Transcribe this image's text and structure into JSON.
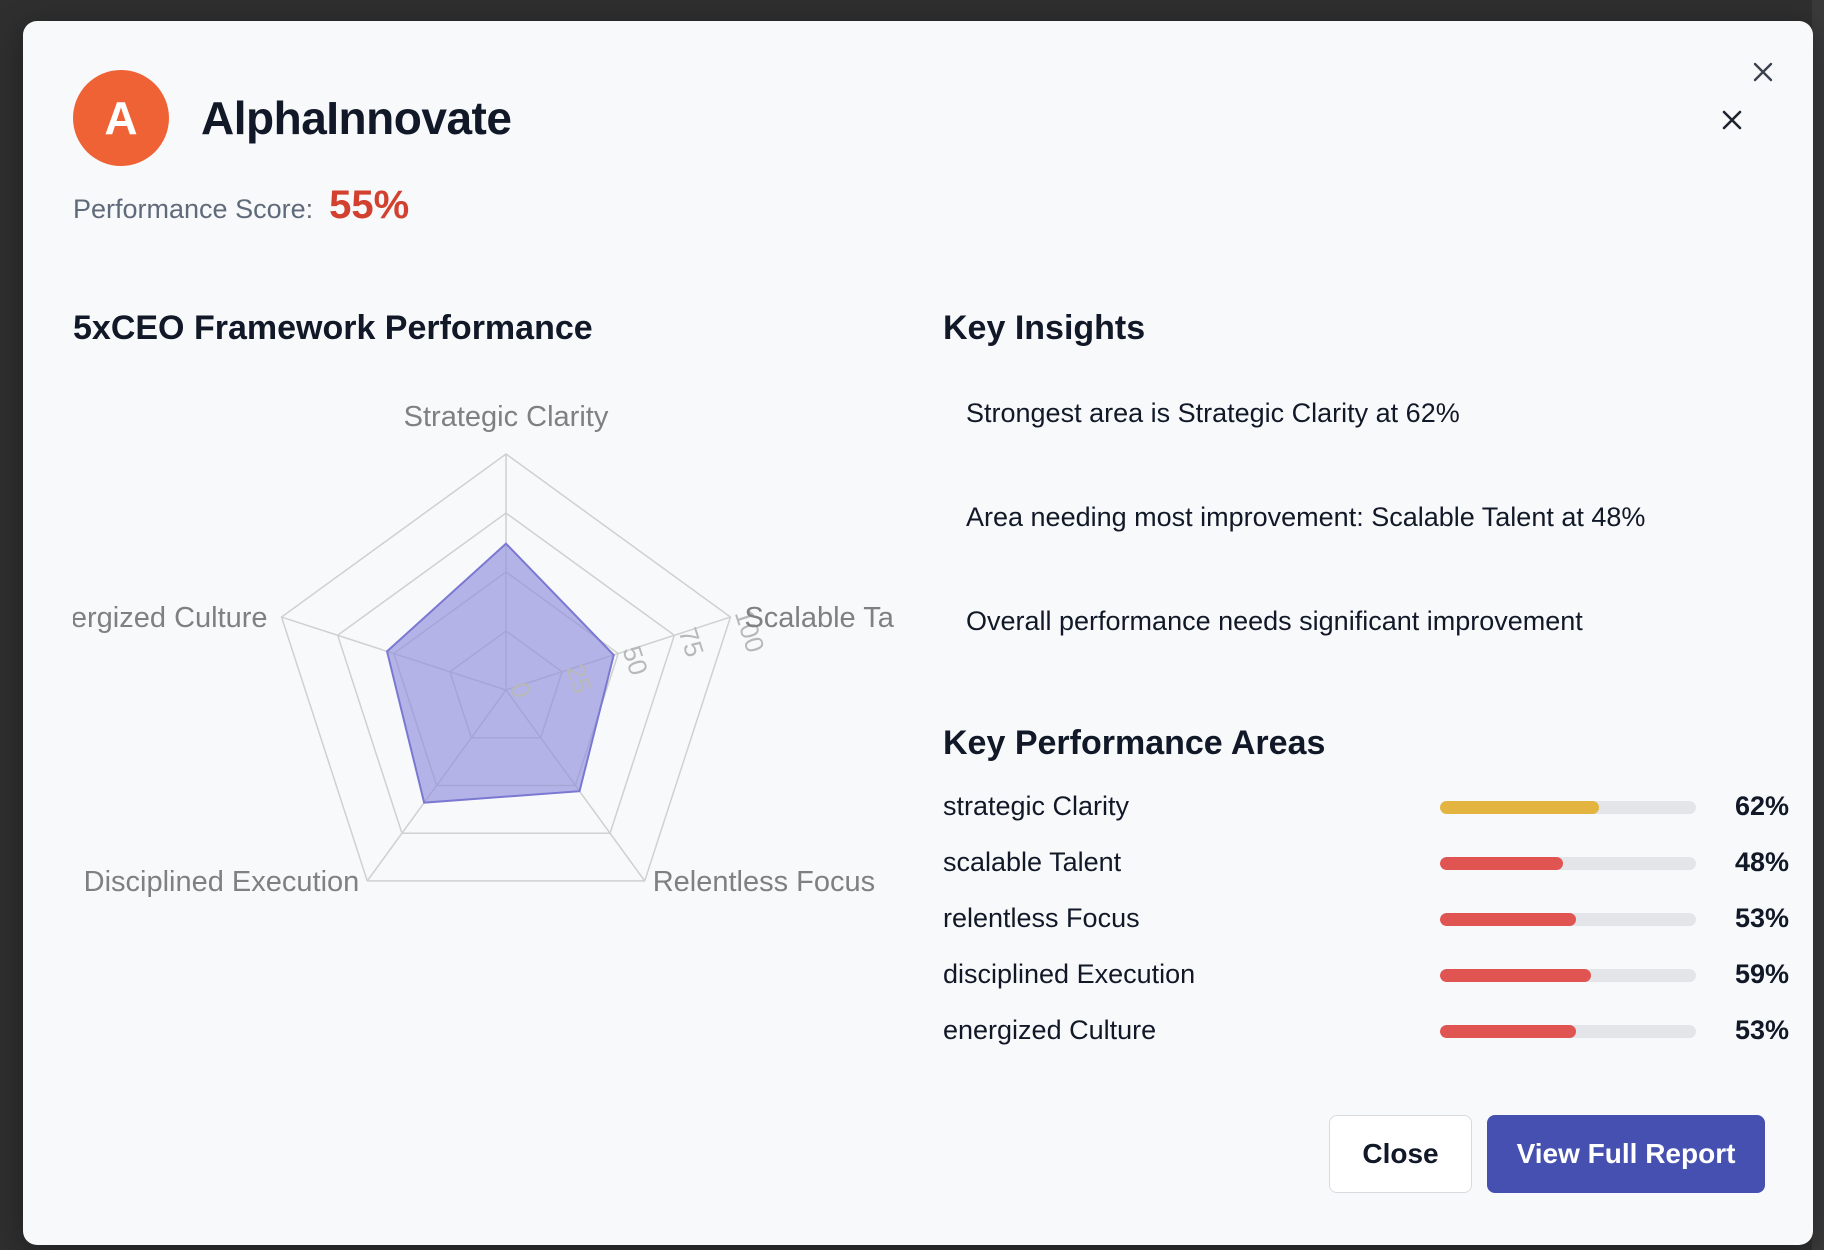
{
  "company": {
    "initial": "A",
    "name": "AlphaInnovate"
  },
  "score": {
    "label": "Performance Score:",
    "value": "55%"
  },
  "framework": {
    "title": "5xCEO Framework Performance"
  },
  "chart_data": {
    "type": "radar",
    "axes": [
      "Strategic Clarity",
      "Scalable Talent",
      "Relentless Focus",
      "Disciplined Execution",
      "Energized Culture"
    ],
    "values": [
      62,
      48,
      53,
      59,
      53
    ],
    "scale_ticks": [
      "0",
      "25",
      "50",
      "75",
      "100"
    ],
    "range": [
      0,
      100
    ],
    "fill_color": "#8f8ddc"
  },
  "insights": {
    "title": "Key Insights",
    "items": [
      "Strongest area is Strategic Clarity at 62%",
      "Area needing most improvement: Scalable Talent at 48%",
      "Overall performance needs significant improvement"
    ]
  },
  "areas": {
    "title": "Key Performance Areas",
    "items": [
      {
        "label": "strategic Clarity",
        "value": 62,
        "pct": "62%",
        "color": "#e3b43f"
      },
      {
        "label": "scalable Talent",
        "value": 48,
        "pct": "48%",
        "color": "#e05452"
      },
      {
        "label": "relentless Focus",
        "value": 53,
        "pct": "53%",
        "color": "#e05452"
      },
      {
        "label": "disciplined Execution",
        "value": 59,
        "pct": "59%",
        "color": "#e05452"
      },
      {
        "label": "energized Culture",
        "value": 53,
        "pct": "53%",
        "color": "#e05452"
      }
    ]
  },
  "buttons": {
    "close": "Close",
    "report": "View Full Report"
  },
  "icons": {
    "close": "close-icon"
  }
}
